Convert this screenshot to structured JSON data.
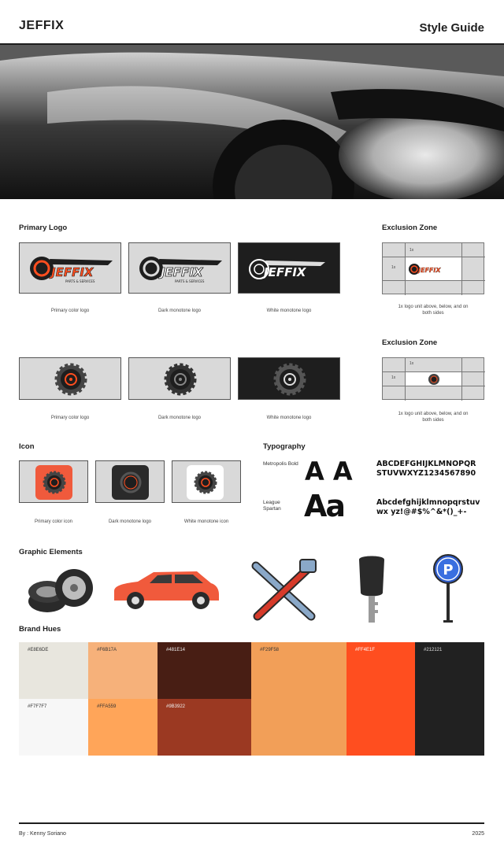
{
  "header": {
    "brand": "JEFFIX",
    "title": "Style Guide"
  },
  "primary_logo": {
    "heading": "Primary Logo",
    "logo_text": "JEFFIX",
    "tagline": "PARTS & SERVICES",
    "captions": [
      "Primary color logo",
      "Dark monotone logo",
      "White monotone logo"
    ]
  },
  "badge_logo": {
    "captions": [
      "Primary color logo",
      "Dark monotone logo",
      "White monotone logo"
    ]
  },
  "exclusion_zone_1": {
    "heading": "Exclusion Zone",
    "unit_label": "1x",
    "caption": "1x logo unit above, below, and on both sides"
  },
  "exclusion_zone_2": {
    "heading": "Exclusion Zone",
    "unit_label": "1x",
    "caption": "1x logo unit above, below, and on both sides"
  },
  "icon": {
    "heading": "Icon",
    "captions": [
      "Primary color icon",
      "Dark monotone logo",
      "White monotone icon"
    ]
  },
  "typography": {
    "heading": "Typography",
    "font1_name": "Metropolis Bold",
    "font1_sample": "A A",
    "font1_upper": "ABCDEFGHIJKLMNOPQR STUVWXYZ1234567890",
    "font2_name": "League Spartan",
    "font2_sample": "Aa",
    "font2_lower": "Abcdefghijklmnopqrstuv wx yz!@#$%^&*()_+-"
  },
  "graphic_elements": {
    "heading": "Graphic Elements",
    "items": [
      "tires-icon",
      "car-icon",
      "tools-icon",
      "car-key-icon",
      "parking-sign-icon"
    ],
    "parking_letter": "P"
  },
  "brand_hues": {
    "heading": "Brand Hues",
    "swatches": [
      {
        "hex": "#E8E6DE",
        "label": "#E8E6DE"
      },
      {
        "hex": "#F6B17A",
        "label": "#F6B17A"
      },
      {
        "hex": "#481E14",
        "label": "#481E14"
      },
      {
        "hex": "#F29F58",
        "label": "#F29F58"
      },
      {
        "hex": "#FF4E1F",
        "label": "#FF4E1F"
      },
      {
        "hex": "#212121",
        "label": "#212121"
      },
      {
        "hex": "#F7F7F7",
        "label": "#F7F7F7"
      },
      {
        "hex": "#FFA559",
        "label": "#FFA559"
      },
      {
        "hex": "#9B3922",
        "label": "#9B3922"
      }
    ]
  },
  "footer": {
    "author": "By : Kenny Soriano",
    "year": "2025"
  }
}
